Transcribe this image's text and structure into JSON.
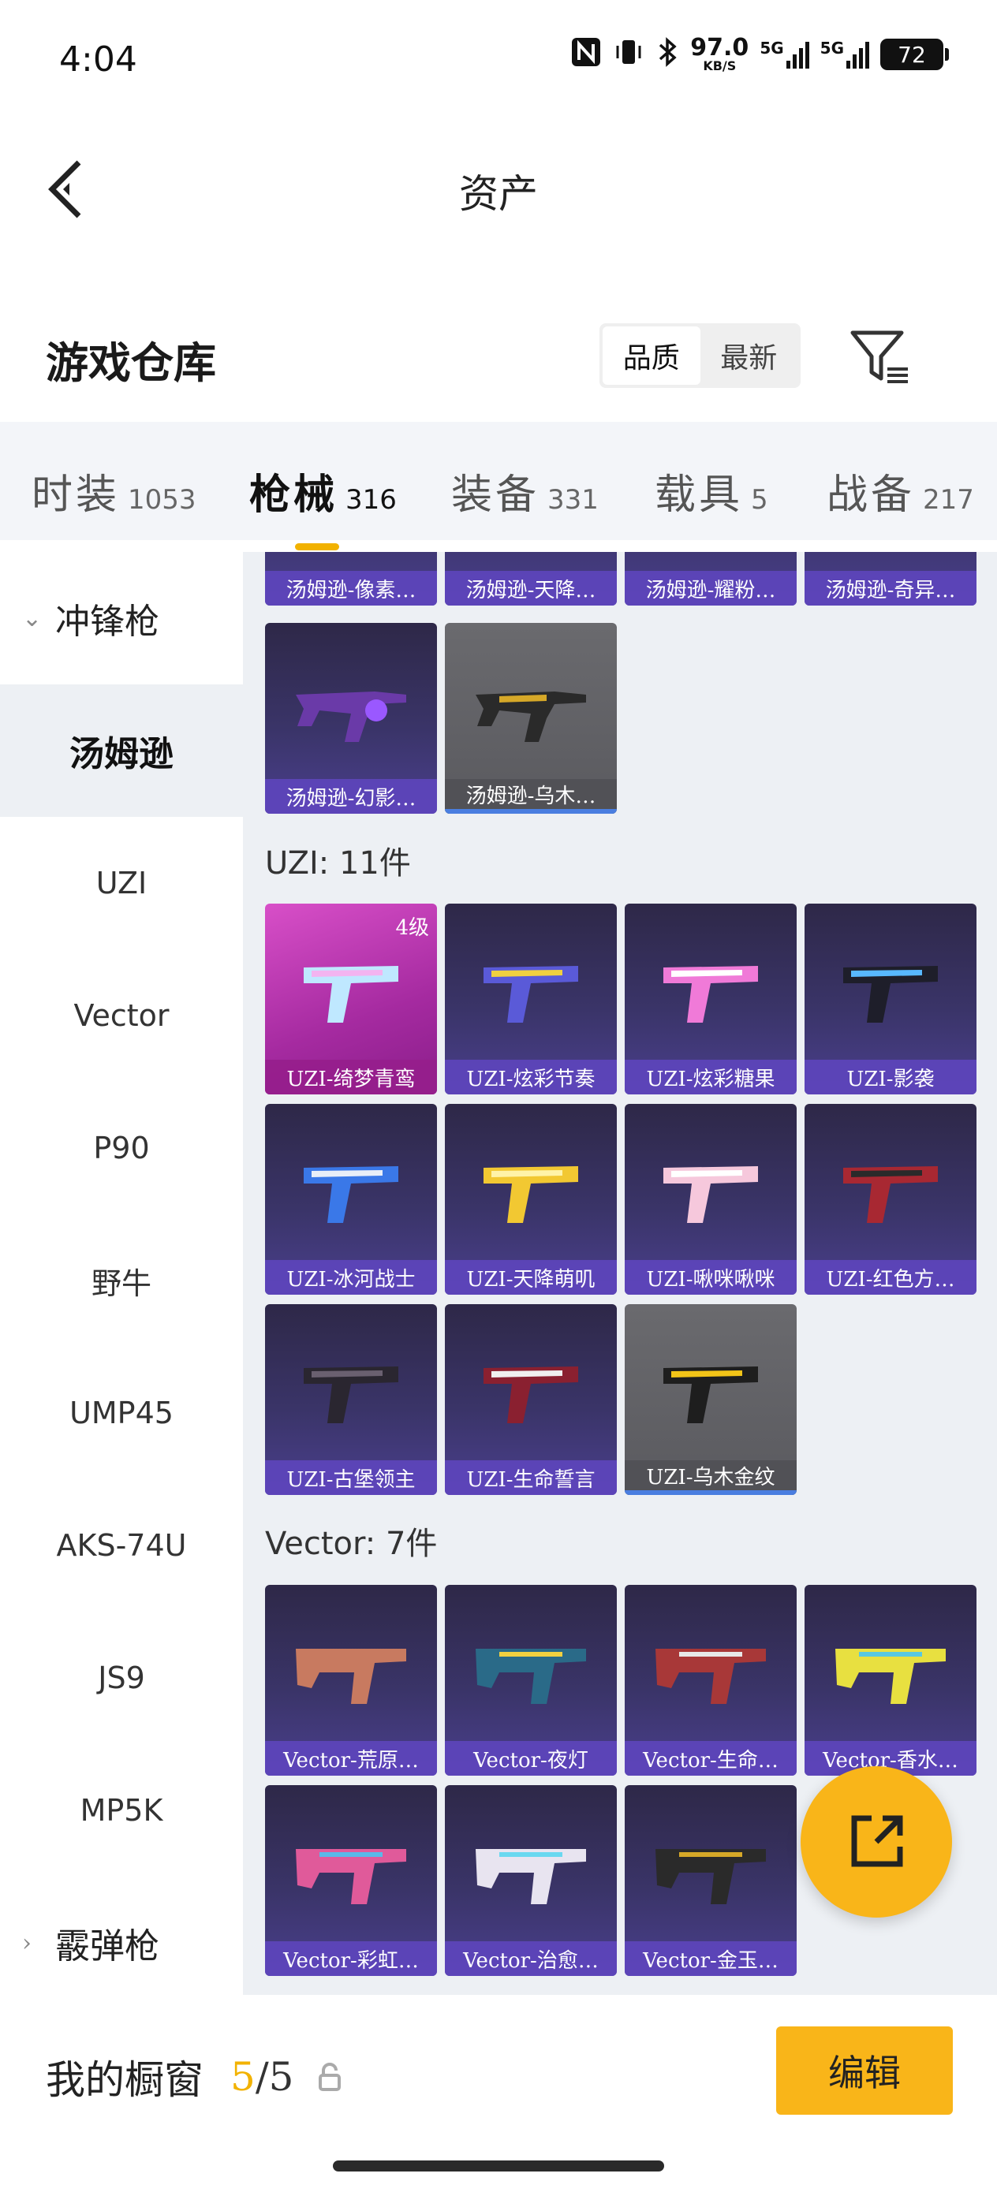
{
  "status_bar": {
    "time": "4:04",
    "net_speed": "97.0",
    "net_unit": "KB/S",
    "sim1": "5G",
    "sim2": "5G",
    "battery": "72"
  },
  "header": {
    "title": "资产"
  },
  "warehouse": {
    "title": "游戏仓库",
    "sort_quality": "品质",
    "sort_newest": "最新"
  },
  "tabs": [
    {
      "label": "时装",
      "count": "1053"
    },
    {
      "label": "枪械",
      "count": "316"
    },
    {
      "label": "装备",
      "count": "331"
    },
    {
      "label": "载具",
      "count": "5"
    },
    {
      "label": "战备",
      "count": "217"
    }
  ],
  "sidebar": {
    "group_smg": "冲锋枪",
    "items": [
      "汤姆逊",
      "UZI",
      "Vector",
      "P90",
      "野牛",
      "UMP45",
      "AKS-74U",
      "JS9",
      "MP5K"
    ],
    "group_shotgun": "霰弹枪"
  },
  "sections": {
    "thompson_top": [
      "汤姆逊-像素…",
      "汤姆逊-天降…",
      "汤姆逊-耀粉…",
      "汤姆逊-奇异…"
    ],
    "thompson_row": [
      "汤姆逊-幻影…",
      "汤姆逊-乌木…"
    ],
    "uzi_title": "UZI: 11件",
    "uzi": [
      "UZI-绮梦青鸾",
      "UZI-炫彩节奏",
      "UZI-炫彩糖果",
      "UZI-影袭",
      "UZI-冰河战士",
      "UZI-天降萌叽",
      "UZI-啾咪啾咪",
      "UZI-红色方…",
      "UZI-古堡领主",
      "UZI-生命誓言",
      "UZI-乌木金纹"
    ],
    "uzi_level": "4级",
    "vector_title": "Vector: 7件",
    "vector": [
      "Vector-荒原…",
      "Vector-夜灯",
      "Vector-生命…",
      "Vector-香水…",
      "Vector-彩虹…",
      "Vector-治愈…",
      "Vector-金玉…"
    ]
  },
  "bottom": {
    "my_window": "我的橱窗",
    "count_current": "5",
    "count_sep": "/",
    "count_max": "5",
    "edit": "编辑"
  },
  "colors": {
    "accent": "#f9b519",
    "indicator": "#f2b200",
    "card_label": "#5f46be"
  }
}
